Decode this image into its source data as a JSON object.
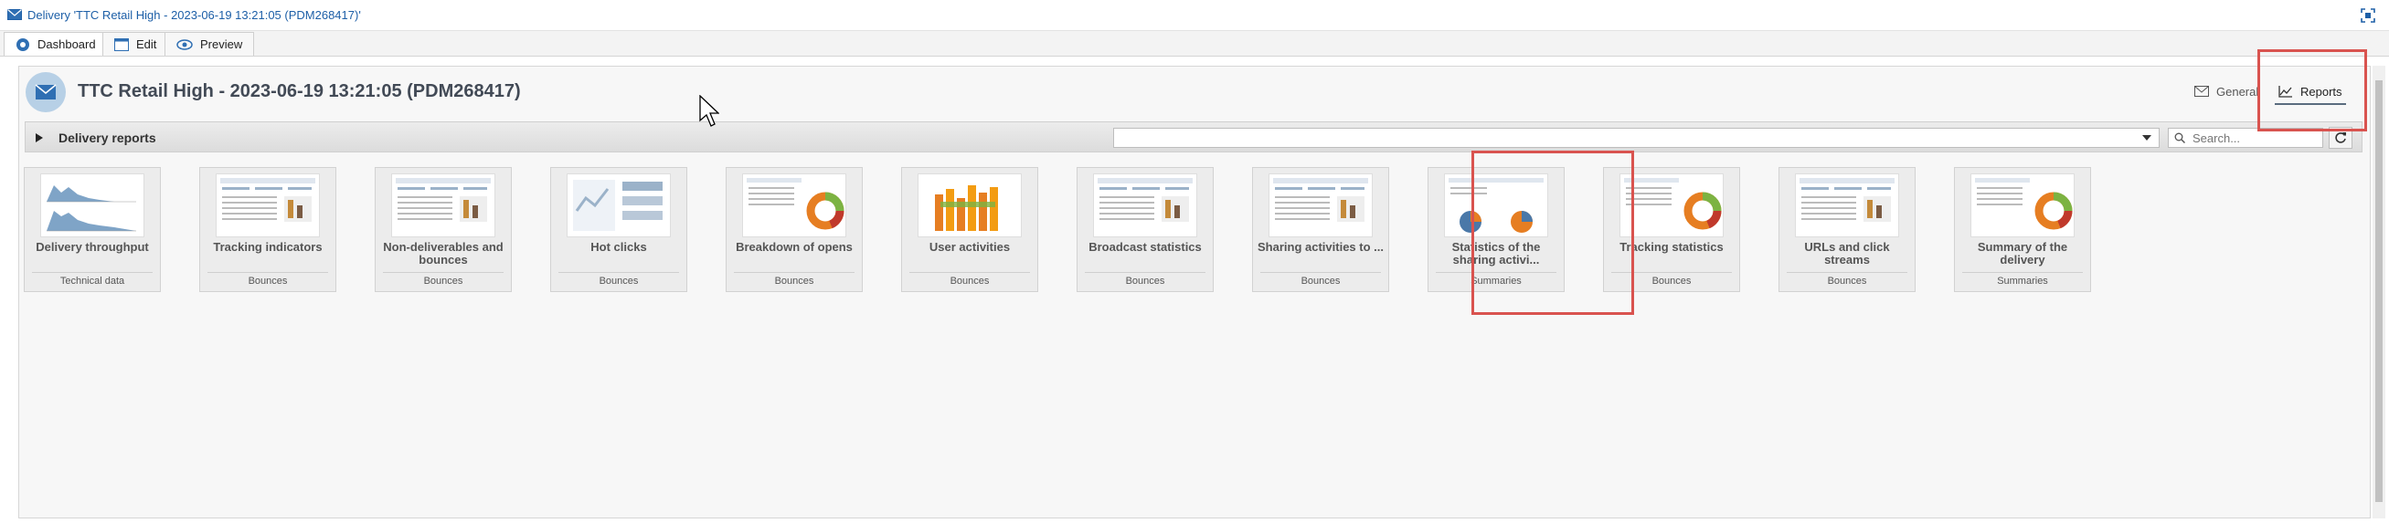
{
  "window": {
    "title": "Delivery 'TTC Retail High - 2023-06-19  13:21:05 (PDM268417)'"
  },
  "tabs": [
    {
      "label": "Dashboard",
      "icon": "dashboard-icon"
    },
    {
      "label": "Edit",
      "icon": "edit-icon"
    },
    {
      "label": "Preview",
      "icon": "eye-icon"
    }
  ],
  "header": {
    "title": "TTC Retail High - 2023-06-19 13:21:05 (PDM268417)",
    "tabs": [
      {
        "label": "General",
        "icon": "envelope-icon"
      },
      {
        "label": "Reports",
        "icon": "line-chart-icon"
      }
    ]
  },
  "reports_bar": {
    "label": "Delivery reports",
    "search_placeholder": "Search..."
  },
  "cards": [
    {
      "title": "Delivery throughput",
      "category": "Technical data",
      "thumb": "area"
    },
    {
      "title": "Tracking indicators",
      "category": "Bounces",
      "thumb": "table"
    },
    {
      "title": "Non-deliverables and bounces",
      "category": "Bounces",
      "thumb": "table"
    },
    {
      "title": "Hot clicks",
      "category": "Bounces",
      "thumb": "hot"
    },
    {
      "title": "Breakdown of opens",
      "category": "Bounces",
      "thumb": "donut"
    },
    {
      "title": "User activities",
      "category": "Bounces",
      "thumb": "bars3d"
    },
    {
      "title": "Broadcast statistics",
      "category": "Bounces",
      "thumb": "table"
    },
    {
      "title": "Sharing activities to ...",
      "category": "Bounces",
      "thumb": "table"
    },
    {
      "title": "Statistics of the sharing activi...",
      "category": "Summaries",
      "thumb": "pies"
    },
    {
      "title": "Tracking statistics",
      "category": "Bounces",
      "thumb": "donut"
    },
    {
      "title": "URLs and click streams",
      "category": "Bounces",
      "thumb": "table"
    },
    {
      "title": "Summary of the delivery",
      "category": "Summaries",
      "thumb": "donut"
    }
  ],
  "colors": {
    "highlight": "#d9534f",
    "title_blue": "#1d5fa7"
  }
}
